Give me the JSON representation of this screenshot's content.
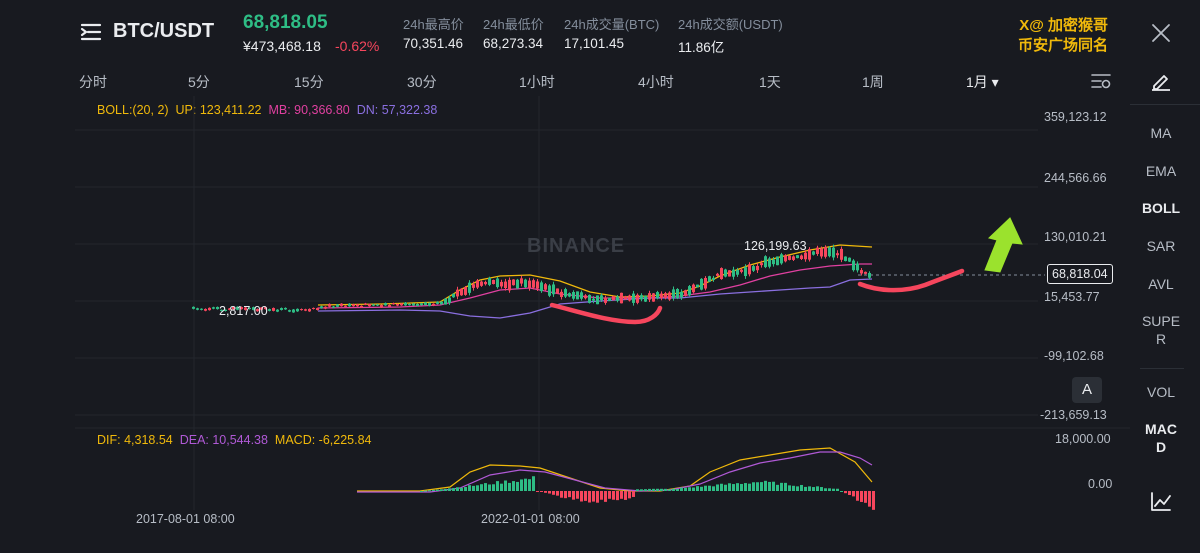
{
  "header": {
    "pair": "BTC/USDT",
    "price": "68,818.05",
    "price_cny": "¥473,468.18",
    "change_pct": "-0.62%",
    "stats": [
      {
        "label": "24h最高价",
        "value": "70,351.46"
      },
      {
        "label": "24h最低价",
        "value": "68,273.34"
      },
      {
        "label": "24h成交量(BTC)",
        "value": "17,101.45"
      },
      {
        "label": "24h成交额(USDT)",
        "value": "11.86亿"
      }
    ],
    "overlay_line1": "X@ 加密猴哥",
    "overlay_line2": "币安广场同名"
  },
  "timeframes": [
    "分时",
    "5分",
    "15分",
    "30分",
    "1小时",
    "4小时",
    "1天",
    "1周",
    "1月 ▾"
  ],
  "active_timeframe": "1月 ▾",
  "indicators": [
    "MA",
    "EMA",
    "BOLL",
    "SAR",
    "SUPE\nR",
    "AVL",
    "VOL",
    "MAC\nD"
  ],
  "active_indicators": [
    "BOLL",
    "MAC\nD"
  ],
  "boll_legend": {
    "name": "BOLL:(20, 2)",
    "up": "UP: 123,411.22",
    "mb": "MB: 90,366.80",
    "dn": "DN: 57,322.38"
  },
  "main_yaxis": [
    "359,123.12",
    "244,566.66",
    "130,010.21",
    "15,453.77",
    "-99,102.68",
    "-213,659.13"
  ],
  "current_price_tag": "68,818.04",
  "high_label": "126,199.63",
  "low_label": "2,817.00",
  "watermark": "BINANCE",
  "a_button": "A",
  "macd_legend": {
    "dif": "DIF: 4,318.54",
    "dea": "DEA: 10,544.38",
    "macd": "MACD: -6,225.84"
  },
  "macd_yaxis": [
    "18,000.00",
    "0.00"
  ],
  "xaxis": [
    "2017-08-01 08:00",
    "2022-01-01 08:00"
  ],
  "colors": {
    "up": "#2ebd85",
    "down": "#f6465d",
    "boll_up": "#f0b90b",
    "boll_mb": "#e040a0",
    "boll_dn": "#8a6fe0",
    "accent": "#f0b90b",
    "annotation_red": "#f6465d",
    "annotation_arrow": "#9be22d"
  }
}
